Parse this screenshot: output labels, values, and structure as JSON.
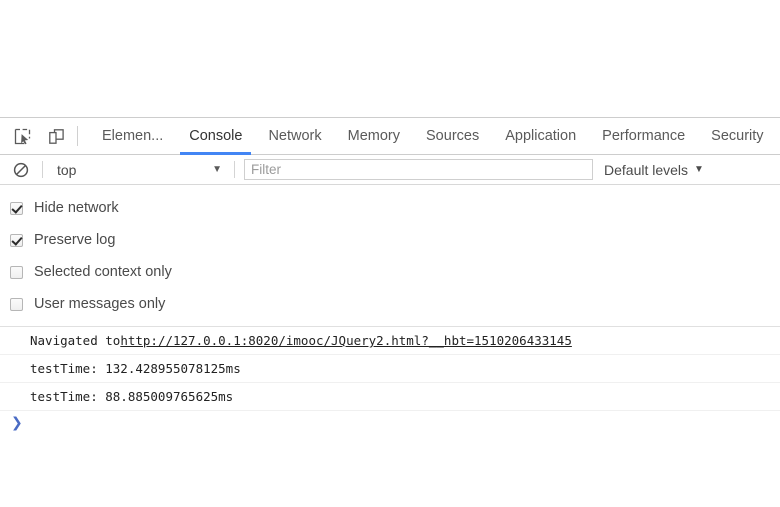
{
  "devtools": {
    "toolbar_icons": [
      {
        "name": "inspect-element-icon",
        "title": "Select an element in the page to inspect it"
      },
      {
        "name": "device-toolbar-icon",
        "title": "Toggle device toolbar"
      }
    ],
    "tabs": [
      {
        "label": "Elemen...",
        "active": false
      },
      {
        "label": "Console",
        "active": true
      },
      {
        "label": "Network",
        "active": false
      },
      {
        "label": "Memory",
        "active": false
      },
      {
        "label": "Sources",
        "active": false
      },
      {
        "label": "Application",
        "active": false
      },
      {
        "label": "Performance",
        "active": false
      },
      {
        "label": "Security",
        "active": false
      }
    ],
    "active_tab": "Console",
    "accent_color": "#4285f4"
  },
  "filterbar": {
    "clear_icon": "clear-console-icon",
    "context": {
      "value": "top",
      "caret": "▼"
    },
    "filter": {
      "value": "",
      "placeholder": "Filter"
    },
    "levels": {
      "value": "Default levels",
      "caret": "▼"
    }
  },
  "settings": {
    "options": [
      {
        "label": "Hide network",
        "checked": true
      },
      {
        "label": "Preserve log",
        "checked": true
      },
      {
        "label": "Selected context only",
        "checked": false
      },
      {
        "label": "User messages only",
        "checked": false
      }
    ]
  },
  "console": {
    "messages": [
      {
        "type": "navigation",
        "prefix": "Navigated to ",
        "link": "http://127.0.0.1:8020/imooc/JQuery2.html?__hbt=1510206433145"
      },
      {
        "type": "log",
        "text": "testTime: 132.428955078125ms"
      },
      {
        "type": "log",
        "text": "testTime: 88.885009765625ms"
      }
    ],
    "prompt": {
      "arrow": "❯",
      "value": "",
      "color": "#4a6bc4"
    }
  }
}
